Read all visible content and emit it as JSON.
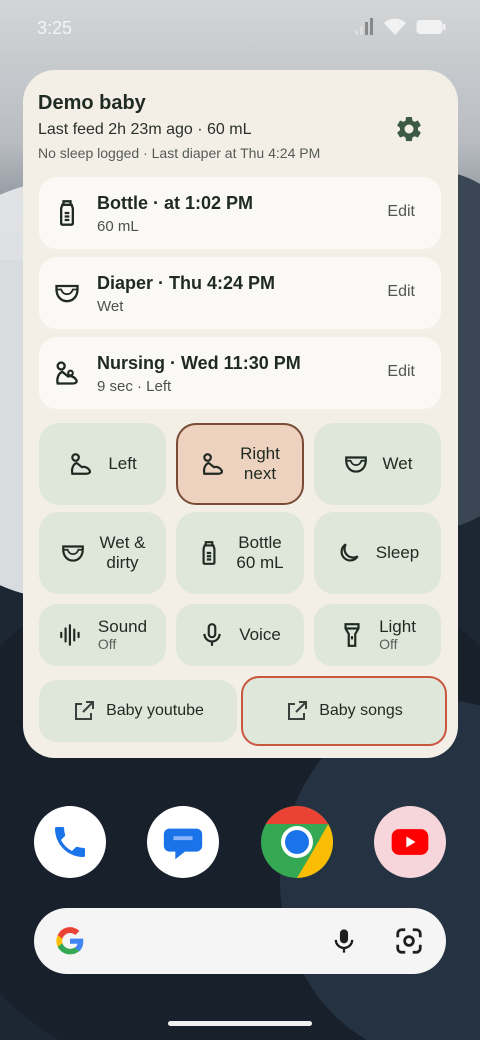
{
  "status_bar": {
    "time": "3:25"
  },
  "widget": {
    "baby_name": "Demo baby",
    "last_feed": "Last feed 2h 23m ago · 60 mL",
    "summary": "No sleep logged · Last diaper at Thu 4:24 PM",
    "events": [
      {
        "icon": "bottle-icon",
        "title": "Bottle · at 1:02 PM",
        "sub": "60 mL",
        "action": "Edit"
      },
      {
        "icon": "diaper-icon",
        "title": "Diaper · Thu 4:24 PM",
        "sub": "Wet",
        "action": "Edit"
      },
      {
        "icon": "nursing-icon",
        "title": "Nursing · Wed 11:30 PM",
        "sub": "9 sec · Left",
        "action": "Edit"
      }
    ],
    "quick_actions": {
      "left": "Left",
      "right_l1": "Right",
      "right_l2": "next",
      "wet": "Wet",
      "wet_dirty_l1": "Wet &",
      "wet_dirty_l2": "dirty",
      "bottle_l1": "Bottle",
      "bottle_l2": "60 mL",
      "sleep": "Sleep"
    },
    "toggles": {
      "sound": "Sound",
      "sound_state": "Off",
      "voice": "Voice",
      "light": "Light",
      "light_state": "Off"
    },
    "links": {
      "youtube": "Baby youtube",
      "songs": "Baby songs"
    }
  },
  "dock": [
    "phone-app",
    "messages-app",
    "chrome-app",
    "youtube-app"
  ],
  "colors": {
    "widget_bg": "#f3efe7",
    "tile_bg": "#dfe6da",
    "active_tile": "#ecd2bf",
    "outline_accent": "#c9573f"
  }
}
